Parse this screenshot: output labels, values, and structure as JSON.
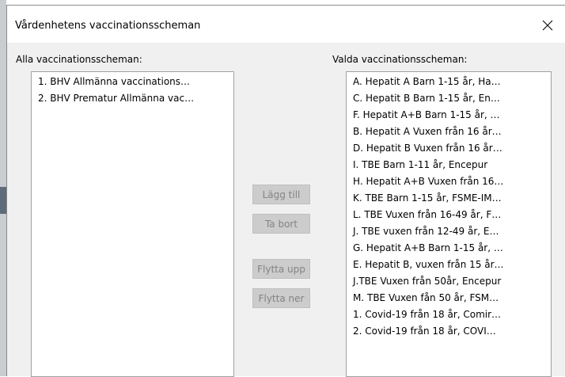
{
  "dialog": {
    "title": "Vårdenhetens vaccinationsscheman"
  },
  "all_schemes": {
    "label": "Alla vaccinationsscheman:",
    "items": [
      "1. BHV Allmänna vaccinations…",
      "2. BHV Prematur Allmänna vac…"
    ]
  },
  "selected_schemes": {
    "label": "Valda vaccinationsscheman:",
    "items": [
      "A. Hepatit A Barn 1-15 år, Ha…",
      "C. Hepatit B Barn 1-15 år, En…",
      "F. Hepatit A+B Barn 1-15 år, …",
      "B. Hepatit A Vuxen från 16 år…",
      "D. Hepatit B Vuxen från 16 år…",
      "I. TBE Barn 1-11 år, Encepur",
      "H. Hepatit A+B Vuxen från 16…",
      "K. TBE Barn 1-15 år, FSME-IM…",
      "L. TBE Vuxen från 16-49 år, F…",
      "J. TBE vuxen från 12-49 år, E…",
      "G. Hepatit A+B Barn 1-15 år, …",
      "E. Hepatit B, vuxen från 15 år…",
      "J.TBE Vuxen från 50år, Encepur",
      "M. TBE Vuxen fån 50 år, FSM…",
      "1. Covid-19 från 18 år, Comir…",
      "2. Covid-19 från 18 år, COVI…"
    ]
  },
  "buttons": {
    "add": "Lägg till",
    "remove": "Ta bort",
    "move_up": "Flytta upp",
    "move_down": "Flytta ner"
  },
  "colors": {
    "dialog_bg": "#f0f0f0",
    "disabled_button_bg": "#cccccc",
    "disabled_button_text": "#838383"
  }
}
